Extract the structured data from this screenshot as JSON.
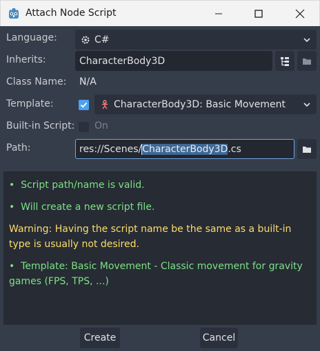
{
  "window": {
    "title": "Attach Node Script"
  },
  "form": {
    "language_label": "Language:",
    "language_value": "C#",
    "inherits_label": "Inherits:",
    "inherits_value": "CharacterBody3D",
    "classname_label": "Class Name:",
    "classname_value": "N/A",
    "template_label": "Template:",
    "template_enabled": true,
    "template_value": "CharacterBody3D: Basic Movement",
    "builtin_label": "Built-in Script:",
    "builtin_toggle_label": "On",
    "path_label": "Path:",
    "path_prefix": "res://Scenes/",
    "path_selected": "CharacterBody3D",
    "path_suffix": ".cs"
  },
  "messages": [
    {
      "type": "ok",
      "bullet": "•",
      "text": "Script path/name is valid."
    },
    {
      "type": "ok",
      "bullet": "•",
      "text": "Will create a new script file."
    },
    {
      "type": "warn",
      "bullet": "",
      "text": "Warning: Having the script name be the same as a built-in type is usually not desired."
    },
    {
      "type": "ok",
      "bullet": "•",
      "text": "Template: Basic Movement - Classic movement for gravity games (FPS, TPS, ...)"
    }
  ],
  "buttons": {
    "create": "Create",
    "cancel": "Cancel"
  },
  "colors": {
    "ok": "#7ee085",
    "warn": "#ffdd6b",
    "accent": "#4ea0f0"
  }
}
